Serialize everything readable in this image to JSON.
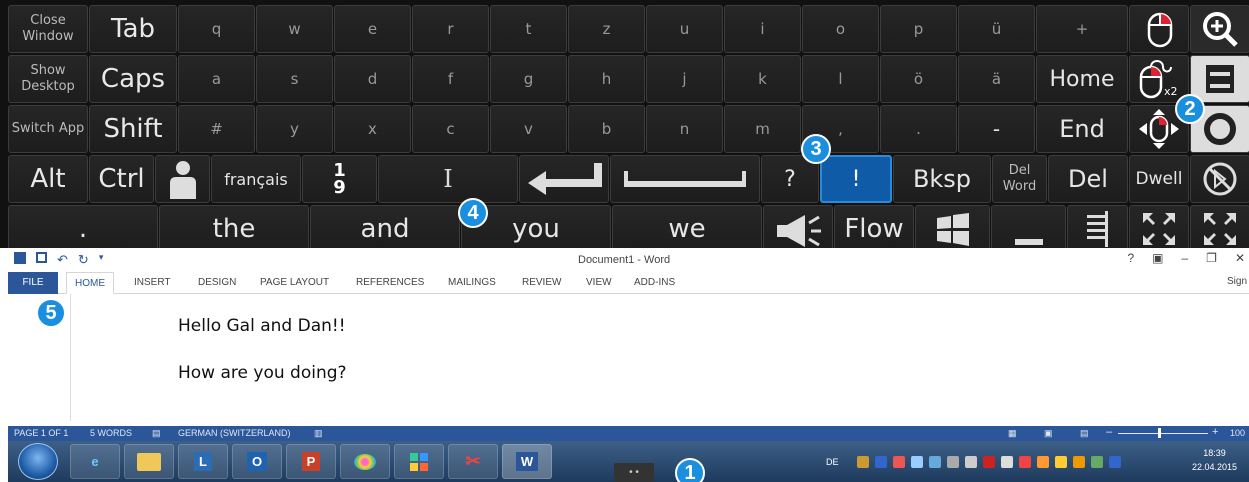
{
  "keyboard": {
    "row1": [
      "Close Window",
      "Tab",
      "q",
      "w",
      "e",
      "r",
      "t",
      "z",
      "u",
      "i",
      "o",
      "p",
      "ü",
      "+"
    ],
    "row2": [
      "Show Desktop",
      "Caps",
      "a",
      "s",
      "d",
      "f",
      "g",
      "h",
      "j",
      "k",
      "l",
      "ö",
      "ä",
      "Home"
    ],
    "row3": [
      "Switch App",
      "Shift",
      "#",
      "y",
      "x",
      "c",
      "v",
      "b",
      "n",
      "m",
      ",",
      ".",
      "-",
      "End"
    ],
    "row4": {
      "alt": "Alt",
      "ctrl": "Ctrl",
      "language": "français",
      "numtop": "1",
      "numbottom": "9",
      "cursor": "I",
      "question": "?",
      "excl": "!",
      "bksp": "Bksp",
      "delword": "Del Word",
      "del": "Del",
      "dwell": "Dwell"
    },
    "row5": {
      "dot": ".",
      "w1": "the",
      "w2": "and",
      "w3": "you",
      "w4": "we",
      "flow": "Flow"
    },
    "mouse_icons": [
      "mouse-left-click-icon",
      "mouse-double-click-icon",
      "mouse-move-icon"
    ],
    "zoom_icons": [
      "zoom-in-icon",
      "window-icon",
      "circle-icon",
      "cancel-icon"
    ]
  },
  "badges": [
    "1",
    "2",
    "3",
    "4",
    "5"
  ],
  "word": {
    "title": "Document1 - Word",
    "help": "?",
    "tabs": [
      "FILE",
      "HOME",
      "INSERT",
      "DESIGN",
      "PAGE LAYOUT",
      "REFERENCES",
      "MAILINGS",
      "REVIEW",
      "VIEW",
      "ADD-INS"
    ],
    "signin": "Sign",
    "lines": [
      "Hello Gal and Dan!!",
      "How are you doing?"
    ],
    "status": {
      "page": "PAGE 1 OF 1",
      "words": "5 WORDS",
      "language": "GERMAN (SWITZERLAND)",
      "zoom": "100"
    }
  },
  "taskbar": {
    "apps": [
      "ie-icon",
      "explorer-icon",
      "lync-icon",
      "outlook-icon",
      "powerpoint-icon",
      "paint-icon",
      "app-icon",
      "snipping-icon",
      "word-icon"
    ],
    "app_labels": {
      "lync": "L",
      "outlook": "O",
      "powerpoint": "P",
      "word": "W"
    },
    "tray_lang": "DE",
    "time": "18:39",
    "date": "22.04.2015"
  },
  "colors": {
    "accent": "#2b579a",
    "badge": "#1a8fe0",
    "selected_key": "#0f5ba7"
  }
}
